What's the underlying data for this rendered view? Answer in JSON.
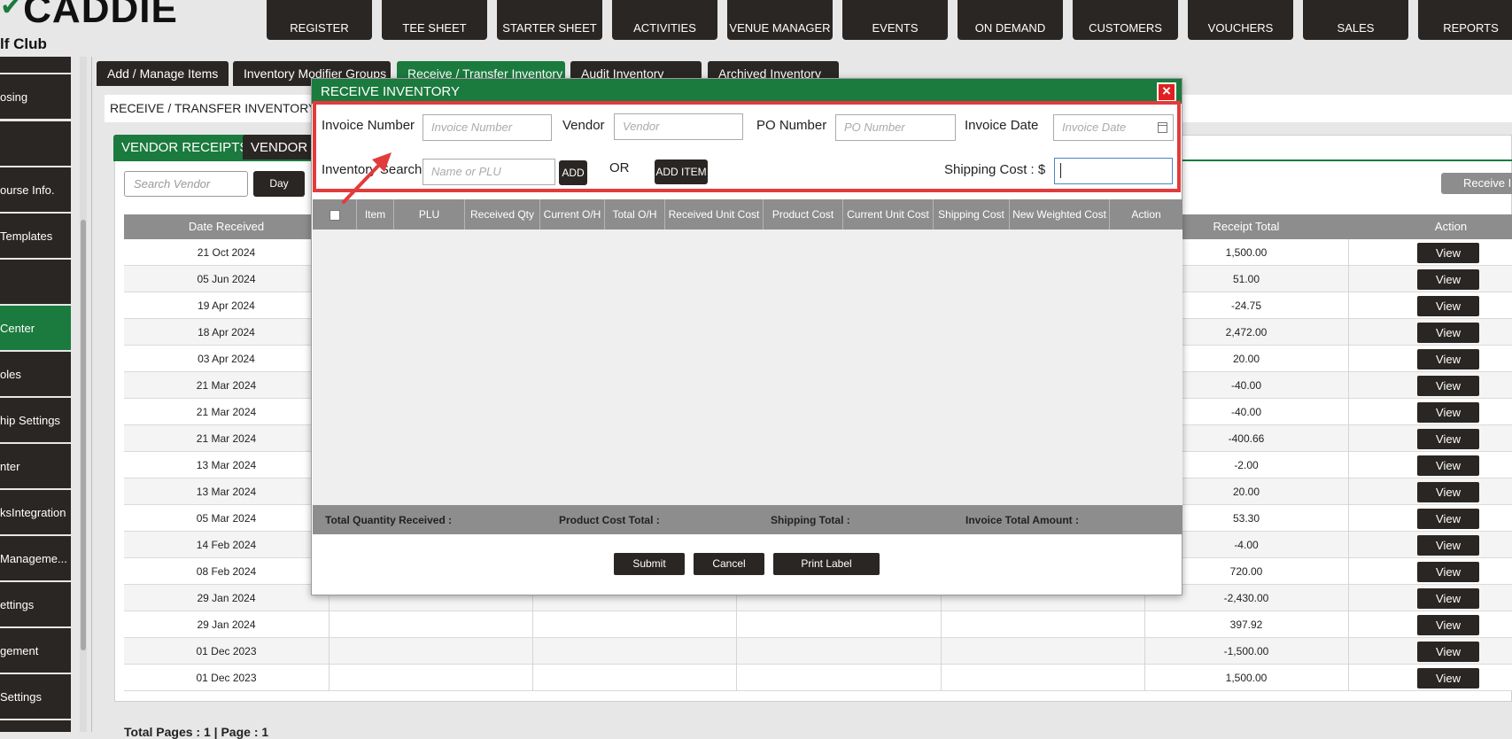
{
  "brand": {
    "logo_text": "CADDIE",
    "club_text": "lf Club"
  },
  "nav": [
    "REGISTER",
    "TEE SHEET",
    "STARTER SHEET",
    "ACTIVITIES",
    "VENUE MANAGER",
    "EVENTS",
    "ON DEMAND",
    "CUSTOMERS",
    "VOUCHERS",
    "SALES",
    "REPORTS"
  ],
  "sidebar": [
    "osing",
    "",
    "ourse Info.",
    "Templates",
    "",
    "Center",
    "oles",
    "hip Settings",
    "nter",
    "ksIntegration",
    " Manageme...",
    "ettings",
    "gement",
    "Settings"
  ],
  "tabs": {
    "add_manage": "Add / Manage Items",
    "modifiers": "Inventory Modifier Groups",
    "receive_transfer": "Receive / Transfer Inventory",
    "audit": "Audit Inventory",
    "archived": "Archived Inventory"
  },
  "section_title": "RECEIVE / TRANSFER INVENTORY",
  "subtabs": {
    "vendor_receipts": "VENDOR RECEIPTS",
    "vendor_other": "VENDOR"
  },
  "search_vendor_placeholder": "Search Vendor",
  "day_button": "Day",
  "receive_button": "Receive Inventory",
  "table": {
    "headers": {
      "date": "Date Received",
      "receipt_total": "Receipt Total",
      "action": "Action"
    },
    "rows": [
      {
        "date": "21 Oct 2024",
        "total": "1,500.00",
        "action": "View"
      },
      {
        "date": "05 Jun 2024",
        "total": "51.00",
        "action": "View"
      },
      {
        "date": "19 Apr 2024",
        "total": "-24.75",
        "action": "View"
      },
      {
        "date": "18 Apr 2024",
        "total": "2,472.00",
        "action": "View"
      },
      {
        "date": "03 Apr 2024",
        "total": "20.00",
        "action": "View"
      },
      {
        "date": "21 Mar 2024",
        "total": "-40.00",
        "action": "View"
      },
      {
        "date": "21 Mar 2024",
        "total": "-40.00",
        "action": "View"
      },
      {
        "date": "21 Mar 2024",
        "total": "-400.66",
        "action": "View"
      },
      {
        "date": "13 Mar 2024",
        "total": "-2.00",
        "action": "View"
      },
      {
        "date": "13 Mar 2024",
        "total": "20.00",
        "action": "View"
      },
      {
        "date": "05 Mar 2024",
        "total": "53.30",
        "action": "View"
      },
      {
        "date": "14 Feb 2024",
        "total": "-4.00",
        "action": "View"
      },
      {
        "date": "08 Feb 2024",
        "total": "720.00",
        "action": "View"
      },
      {
        "date": "29 Jan 2024",
        "total": "-2,430.00",
        "action": "View"
      },
      {
        "date": "29 Jan 2024",
        "total": "397.92",
        "action": "View"
      },
      {
        "date": "01 Dec 2023",
        "total": "-1,500.00",
        "action": "View"
      },
      {
        "date": "01 Dec 2023",
        "total": "1,500.00",
        "action": "View"
      }
    ]
  },
  "total_pages_text": "Total Pages : 1 | Page : 1",
  "modal": {
    "title": "RECEIVE INVENTORY",
    "close": "×",
    "invoice_number_label": "Invoice Number",
    "invoice_number_placeholder": "Invoice Number",
    "vendor_label": "Vendor",
    "vendor_placeholder": "Vendor",
    "po_label": "PO Number",
    "po_placeholder": "PO Number",
    "invoice_date_label": "Invoice Date",
    "invoice_date_placeholder": "Invoice Date",
    "inventory_search_label": "Inventory Search",
    "inventory_search_placeholder": "Name or PLU",
    "add_button": "ADD",
    "or_text": "OR",
    "add_item_button": "ADD ITEM",
    "shipping_cost_label": "Shipping Cost :  $",
    "shipping_cost_value": "",
    "columns": [
      "Item",
      "PLU",
      "Received Qty",
      "Current O/H",
      "Total O/H",
      "Received Unit Cost",
      "Product Cost",
      "Current Unit Cost",
      "Shipping Cost",
      "New Weighted Cost",
      "Action"
    ],
    "totals": {
      "qty": "Total Quantity Received :",
      "product_cost": "Product Cost Total :",
      "shipping": "Shipping Total :",
      "invoice_total": "Invoice Total Amount :"
    },
    "buttons": {
      "submit": "Submit",
      "cancel": "Cancel",
      "print": "Print Label"
    }
  },
  "colors": {
    "brand_green": "#1b7a3e",
    "dark": "#2a2623",
    "highlight_red": "#e23b3b"
  }
}
